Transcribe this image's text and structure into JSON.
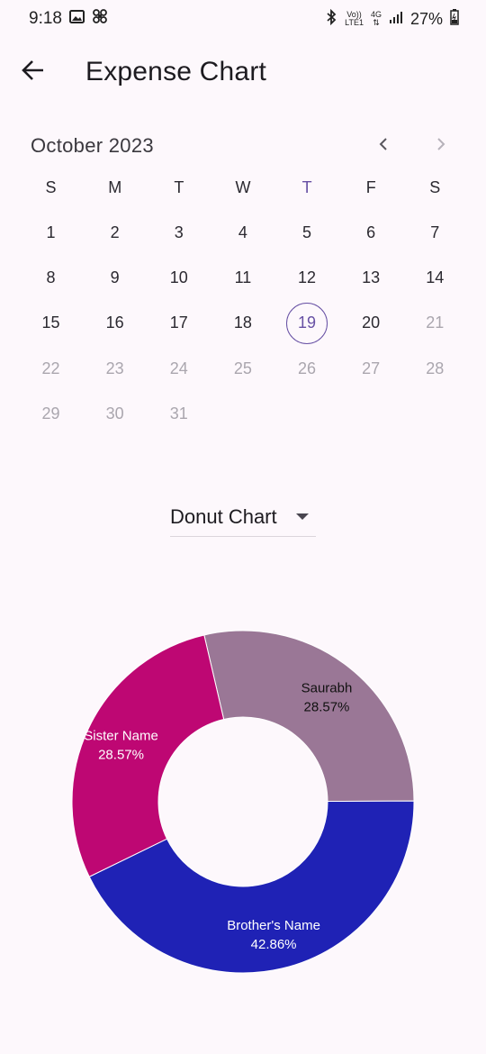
{
  "status_bar": {
    "time": "9:18",
    "left_icons": [
      "image-icon",
      "pinwheel-icon"
    ],
    "volte_top": "Vo))",
    "volte_bottom": "LTE1",
    "network_top": "4G",
    "network_bottom": "⇅",
    "battery": "27%"
  },
  "app_bar": {
    "title": "Expense Chart"
  },
  "calendar": {
    "month_label": "October 2023",
    "weekdays": [
      "S",
      "M",
      "T",
      "W",
      "T",
      "F",
      "S"
    ],
    "today_weekday_index": 4,
    "leading_blank_days": 0,
    "days": [
      "1",
      "2",
      "3",
      "4",
      "5",
      "6",
      "7",
      "8",
      "9",
      "10",
      "11",
      "12",
      "13",
      "14",
      "15",
      "16",
      "17",
      "18",
      "19",
      "20",
      "21",
      "22",
      "23",
      "24",
      "25",
      "26",
      "27",
      "28",
      "29",
      "30",
      "31"
    ],
    "selected_day": "19",
    "last_enabled_day": 20
  },
  "chart_selector": {
    "value": "Donut Chart"
  },
  "chart_data": {
    "type": "pie",
    "style": "donut",
    "slices": [
      {
        "label": "Saurabh",
        "percent_label": "28.57%",
        "value": 28.57,
        "color": "#9a7796",
        "text_color": "#111111"
      },
      {
        "label": "Brother's Name",
        "percent_label": "42.86%",
        "value": 42.86,
        "color": "#1f22b5",
        "text_color": "#ffffff"
      },
      {
        "label": "Sister Name",
        "percent_label": "28.57%",
        "value": 28.57,
        "color": "#be0773",
        "text_color": "#ffffff"
      }
    ]
  },
  "colors": {
    "accent": "#6750a4",
    "background": "#fdf8fc"
  }
}
